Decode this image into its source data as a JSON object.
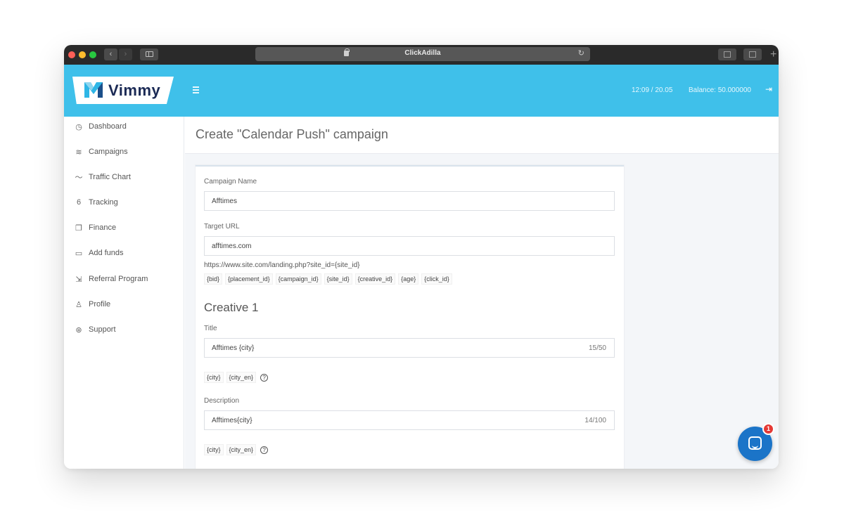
{
  "browser": {
    "url_title": "ClickAdilla"
  },
  "header": {
    "logo_text": "Vimmy",
    "time": "12:09 / 20.05",
    "balance": "Balance: 50.000000"
  },
  "sidebar": {
    "items": [
      {
        "label": "Dashboard",
        "icon": "dashboard-icon"
      },
      {
        "label": "Campaigns",
        "icon": "layers-icon"
      },
      {
        "label": "Traffic Chart",
        "icon": "trend-icon"
      },
      {
        "label": "Tracking",
        "icon": "tracking-icon"
      },
      {
        "label": "Finance",
        "icon": "finance-icon"
      },
      {
        "label": "Add funds",
        "icon": "folder-icon"
      },
      {
        "label": "Referral Program",
        "icon": "referral-icon"
      },
      {
        "label": "Profile",
        "icon": "user-icon"
      },
      {
        "label": "Support",
        "icon": "support-icon"
      }
    ]
  },
  "page": {
    "title": "Create \"Calendar Push\" campaign"
  },
  "form": {
    "campaign_name_label": "Campaign Name",
    "campaign_name_value": "Afftimes",
    "target_url_label": "Target URL",
    "target_url_value": "afftimes.com",
    "url_example": "https://www.site.com/landing.php?site_id={site_id}",
    "url_macros": [
      "{bid}",
      "{placement_id}",
      "{campaign_id}",
      "{site_id}",
      "{creative_id}",
      "{age}",
      "{click_id}"
    ],
    "creative_heading": "Creative 1",
    "title_label": "Title",
    "title_value": "Afftimes {city}",
    "title_counter": "15/50",
    "title_macros": [
      "{city}",
      "{city_en}"
    ],
    "description_label": "Description",
    "description_value": "Afftimes{city}",
    "description_counter": "14/100",
    "description_macros": [
      "{city}",
      "{city_en}"
    ]
  },
  "chat": {
    "badge_count": "1"
  },
  "colors": {
    "header_blue": "#3fc0ea",
    "chat_blue": "#1b74c8",
    "badge_red": "#e53935"
  }
}
